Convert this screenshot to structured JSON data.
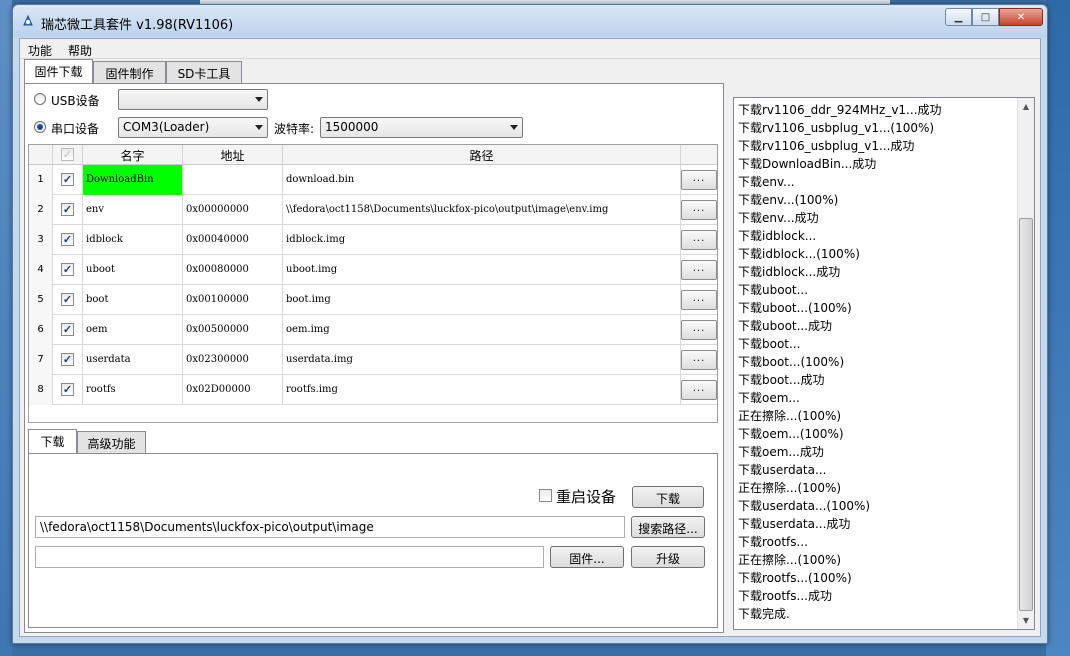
{
  "window": {
    "title": "瑞芯微工具套件 v1.98(RV1106)"
  },
  "menu": [
    "功能",
    "帮助"
  ],
  "tabs": [
    "固件下载",
    "固件制作",
    "SD卡工具"
  ],
  "device": {
    "usb_label": "USB设备",
    "usb_value": "",
    "serial_label": "串口设备",
    "serial_value": "COM3(Loader)",
    "baud_label": "波特率:",
    "baud_value": "1500000"
  },
  "grid": {
    "columns": [
      "名字",
      "地址",
      "路径"
    ],
    "rows": [
      {
        "num": "1",
        "name": "DownloadBin",
        "addr": "",
        "path": "download.bin",
        "btn": "..."
      },
      {
        "num": "2",
        "name": "env",
        "addr": "0x00000000",
        "path": "\\\\fedora\\oct1158\\Documents\\luckfox-pico\\output\\image\\env.img",
        "btn": "..."
      },
      {
        "num": "3",
        "name": "idblock",
        "addr": "0x00040000",
        "path": "idblock.img",
        "btn": "..."
      },
      {
        "num": "4",
        "name": "uboot",
        "addr": "0x00080000",
        "path": "uboot.img",
        "btn": "..."
      },
      {
        "num": "5",
        "name": "boot",
        "addr": "0x00100000",
        "path": "boot.img",
        "btn": "..."
      },
      {
        "num": "6",
        "name": "oem",
        "addr": "0x00500000",
        "path": "oem.img",
        "btn": "..."
      },
      {
        "num": "7",
        "name": "userdata",
        "addr": "0x02300000",
        "path": "userdata.img",
        "btn": "..."
      },
      {
        "num": "8",
        "name": "rootfs",
        "addr": "0x02D00000",
        "path": "rootfs.img",
        "btn": "..."
      }
    ],
    "highlight_color": "#00ff00"
  },
  "subtabs": [
    "下载",
    "高级功能"
  ],
  "download": {
    "restart_label": "重启设备",
    "download_btn": "下载",
    "path_value": "\\\\fedora\\oct1158\\Documents\\luckfox-pico\\output\\image",
    "search_btn": "搜索路径...",
    "firmware_value": "",
    "firmware_btn": "固件...",
    "upgrade_btn": "升级"
  },
  "log": [
    "下载rv1106_ddr_924MHz_v1...成功",
    "下载rv1106_usbplug_v1...(100%)",
    "下载rv1106_usbplug_v1...成功",
    "下载DownloadBin...成功",
    "下载env...",
    "下载env...(100%)",
    "下载env...成功",
    "下载idblock...",
    "下载idblock...(100%)",
    "下载idblock...成功",
    "下载uboot...",
    "下载uboot...(100%)",
    "下载uboot...成功",
    "下载boot...",
    "下载boot...(100%)",
    "下载boot...成功",
    "下载oem...",
    "正在擦除...(100%)",
    "下载oem...(100%)",
    "下载oem...成功",
    "下载userdata...",
    "正在擦除...(100%)",
    "下载userdata...(100%)",
    "下载userdata...成功",
    "下载rootfs...",
    "正在擦除...(100%)",
    "下载rootfs...(100%)",
    "下载rootfs...成功",
    "下载完成."
  ]
}
